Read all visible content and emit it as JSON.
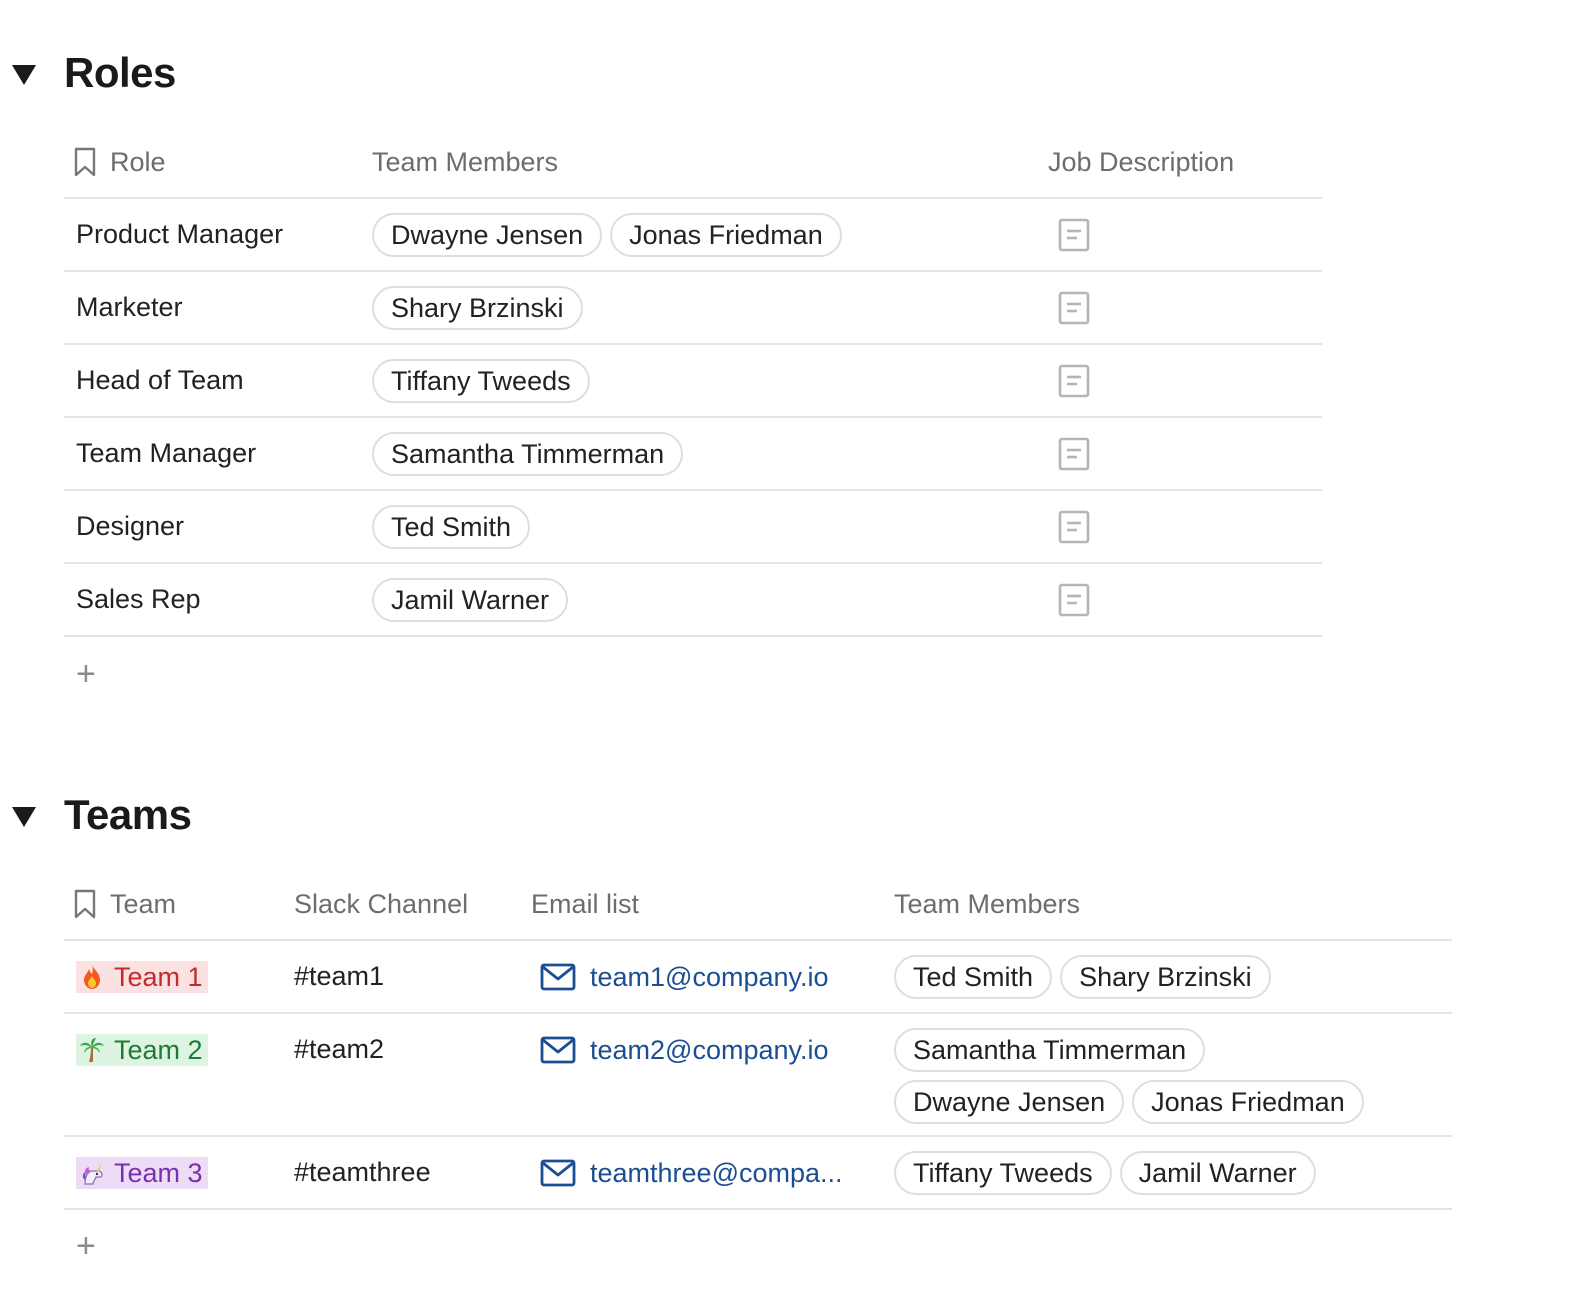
{
  "roles": {
    "title": "Roles",
    "columns": {
      "role": "Role",
      "members": "Team Members",
      "description": "Job Description"
    },
    "rows": [
      {
        "role": "Product Manager",
        "members": [
          "Dwayne Jensen",
          "Jonas Friedman"
        ]
      },
      {
        "role": "Marketer",
        "members": [
          "Shary Brzinski"
        ]
      },
      {
        "role": "Head of Team",
        "members": [
          "Tiffany Tweeds"
        ]
      },
      {
        "role": "Team Manager",
        "members": [
          "Samantha Timmerman"
        ]
      },
      {
        "role": "Designer",
        "members": [
          "Ted Smith"
        ]
      },
      {
        "role": "Sales Rep",
        "members": [
          "Jamil Warner"
        ]
      }
    ],
    "add_label": "+"
  },
  "teams": {
    "title": "Teams",
    "columns": {
      "team": "Team",
      "slack": "Slack Channel",
      "email": "Email list",
      "members": "Team Members"
    },
    "rows": [
      {
        "team": "Team 1",
        "emoji": "fire",
        "text_color": "#c42b2b",
        "bg_color": "#fbe1e1",
        "slack": "#team1",
        "email": "team1@company.io",
        "members": [
          "Ted Smith",
          "Shary Brzinski"
        ]
      },
      {
        "team": "Team 2",
        "emoji": "palm-tree",
        "text_color": "#1f7a35",
        "bg_color": "#def4e2",
        "slack": "#team2",
        "email": "team2@company.io",
        "members": [
          "Samantha Timmerman",
          "Dwayne Jensen",
          "Jonas Friedman"
        ]
      },
      {
        "team": "Team 3",
        "emoji": "unicorn",
        "text_color": "#7a2fb0",
        "bg_color": "#eedcf7",
        "slack": "#teamthree",
        "email": "teamthree@compa...",
        "members": [
          "Tiffany Tweeds",
          "Jamil Warner"
        ]
      }
    ],
    "add_label": "+"
  },
  "colors": {
    "email_link": "#1c4e93",
    "header_text": "#6d6d6d",
    "divider": "#e4e4e4"
  }
}
